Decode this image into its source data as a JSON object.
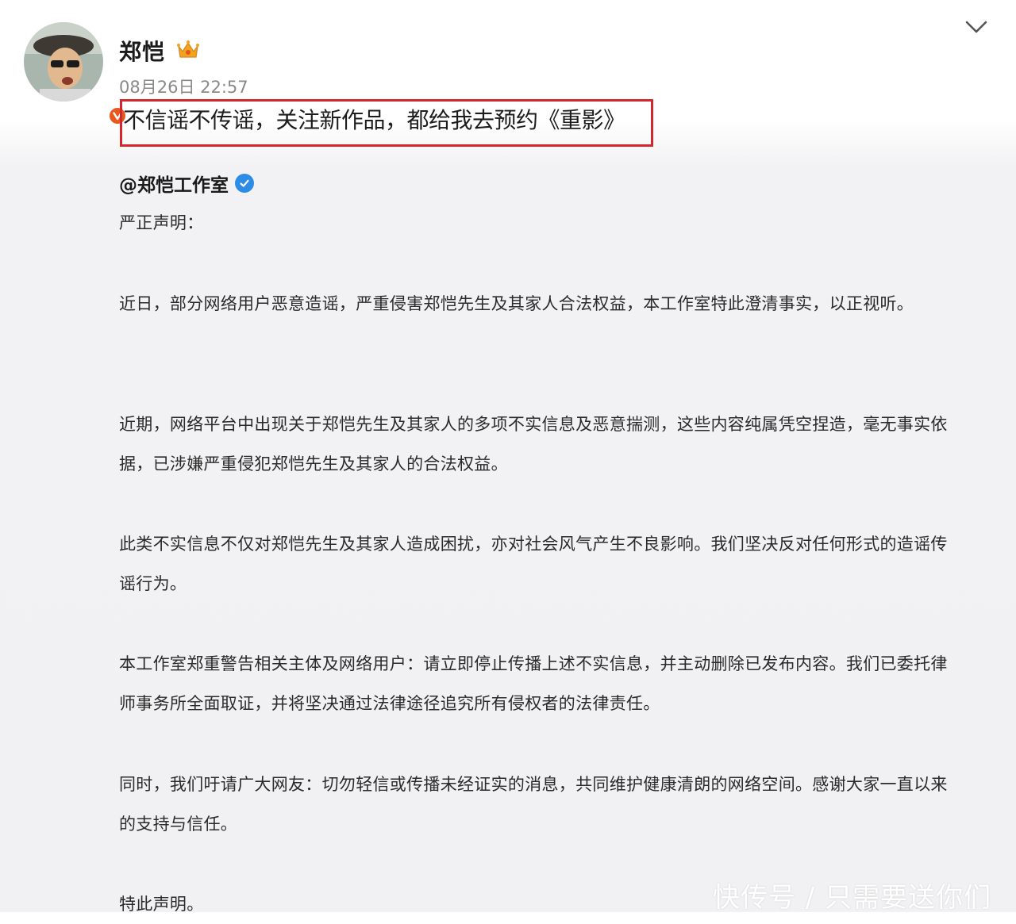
{
  "post": {
    "username": "郑恺",
    "timestamp": "08月26日 22:57",
    "text": "不信谣不传谣，关注新作品，都给我去预约《重影》"
  },
  "repost": {
    "mention": "@郑恺工作室",
    "title": "严正声明：",
    "paragraphs": [
      "近日，部分网络用户恶意造谣，严重侵害郑恺先生及其家人合法权益，本工作室特此澄清事实，以正视听。",
      "近期，网络平台中出现关于郑恺先生及其家人的多项不实信息及恶意揣测，这些内容纯属凭空捏造，毫无事实依据，已涉嫌严重侵犯郑恺先生及其家人的合法权益。",
      "此类不实信息不仅对郑恺先生及其家人造成困扰，亦对社会风气产生不良影响。我们坚决反对任何形式的造谣传谣行为。",
      "本工作室郑重警告相关主体及网络用户：请立即停止传播上述不实信息，并主动删除已发布内容。我们已委托律师事务所全面取证，并将坚决通过法律途径追究所有侵权者的法律责任。",
      "同时，我们吁请广大网友：切勿轻信或传播未经证实的消息，共同维护健康清朗的网络空间。感谢大家一直以来的支持与信任。",
      "特此声明。"
    ]
  },
  "watermark": "快传号 / 只需要送你们",
  "icons": {
    "crown": "crown-icon",
    "verified_personal": "v-badge-icon",
    "verified_org": "verified-check-icon",
    "more": "chevron-down-icon"
  },
  "colors": {
    "highlight_border": "#d4262d",
    "badge_orange": "#e8581c",
    "verify_blue": "#2d8ce6"
  }
}
